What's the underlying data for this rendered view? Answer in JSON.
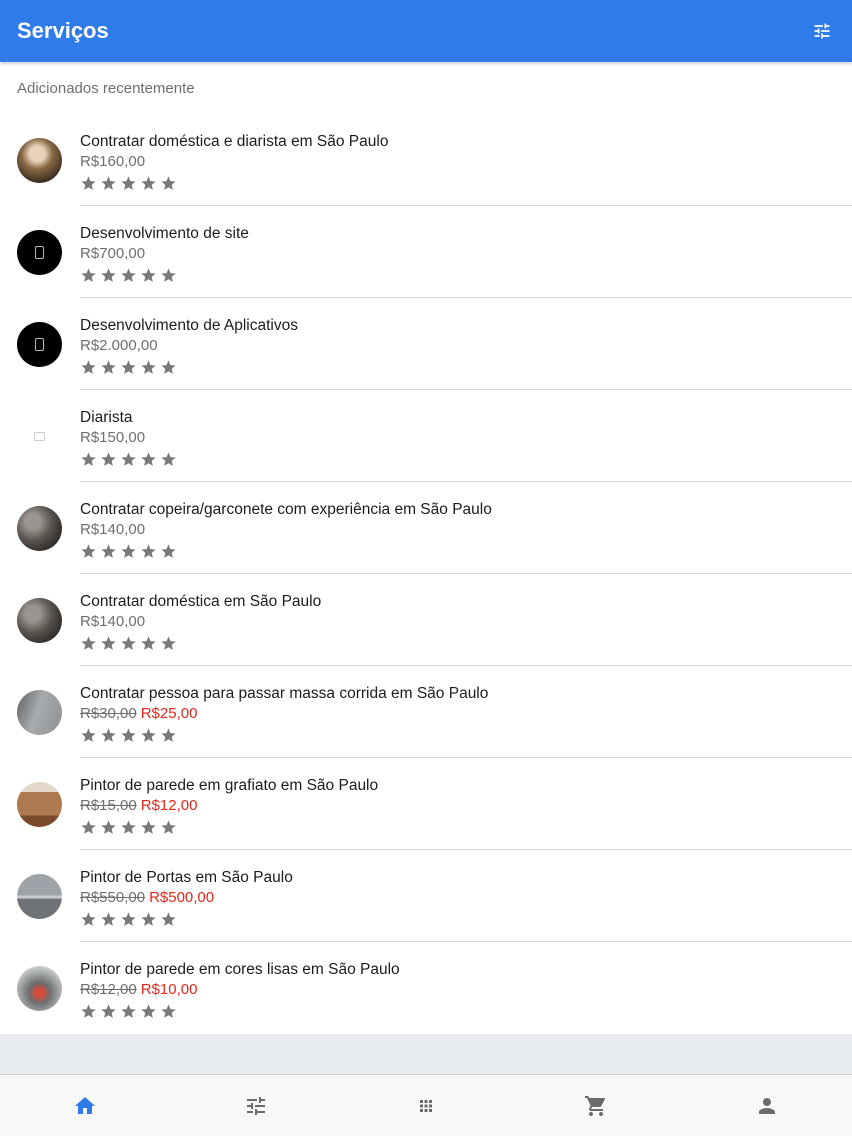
{
  "header": {
    "title": "Serviços"
  },
  "section": {
    "title": "Adicionados recentemente"
  },
  "services": [
    {
      "title": "Contratar doméstica e diarista em São Paulo",
      "price": "R$160,00",
      "old_price": "",
      "sale_price": "",
      "rating": 0
    },
    {
      "title": "Desenvolvimento de site",
      "price": "R$700,00",
      "old_price": "",
      "sale_price": "",
      "rating": 0
    },
    {
      "title": "Desenvolvimento de Aplicativos",
      "price": "R$2.000,00",
      "old_price": "",
      "sale_price": "",
      "rating": 0
    },
    {
      "title": "Diarista",
      "price": "R$150,00",
      "old_price": "",
      "sale_price": "",
      "rating": 0
    },
    {
      "title": "Contratar copeira/garconete com experiência em São Paulo",
      "price": "R$140,00",
      "old_price": "",
      "sale_price": "",
      "rating": 0
    },
    {
      "title": "Contratar doméstica em São Paulo",
      "price": "R$140,00",
      "old_price": "",
      "sale_price": "",
      "rating": 0
    },
    {
      "title": "Contratar pessoa para passar massa corrida em São Paulo",
      "price": "",
      "old_price": "R$30,00",
      "sale_price": "R$25,00",
      "rating": 0
    },
    {
      "title": "Pintor de parede em grafiato em São Paulo",
      "price": "",
      "old_price": "R$15,00",
      "sale_price": "R$12,00",
      "rating": 0
    },
    {
      "title": "Pintor de Portas em São Paulo",
      "price": "",
      "old_price": "R$550,00",
      "sale_price": "R$500,00",
      "rating": 0
    },
    {
      "title": "Pintor de parede em cores lisas em São Paulo",
      "price": "",
      "old_price": "R$12,00",
      "sale_price": "R$10,00",
      "rating": 0
    }
  ],
  "bottom_nav": [
    {
      "icon": "home-icon",
      "active": true
    },
    {
      "icon": "tune-icon",
      "active": false
    },
    {
      "icon": "apps-grid-icon",
      "active": false
    },
    {
      "icon": "cart-icon",
      "active": false
    },
    {
      "icon": "person-icon",
      "active": false
    }
  ],
  "colors": {
    "primary": "#2f7bea",
    "sale": "#e0291b",
    "star": "#7a7a7a",
    "nav_inactive": "#6b6b6b"
  }
}
